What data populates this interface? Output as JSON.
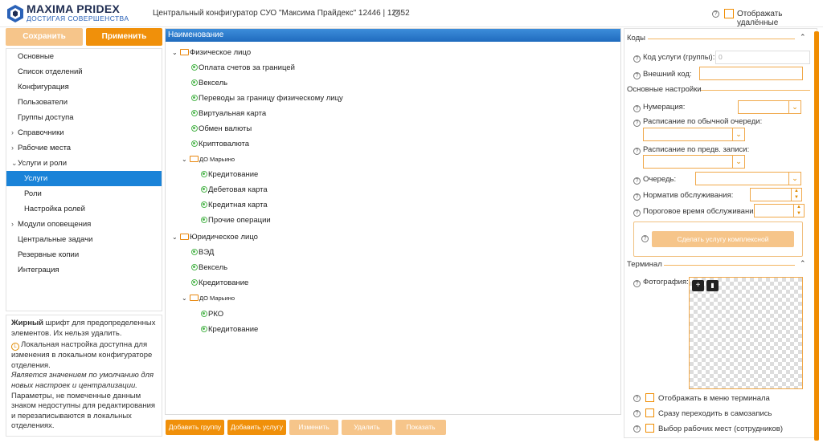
{
  "header": {
    "brand_name": "MAXIMA PRIDEX",
    "brand_tagline": "ДОСТИГАЯ СОВЕРШЕНСТВА",
    "title": "Центральный конфигуратор СУО \"Максима Прайдекс\" 12446 | 12452",
    "show_deleted_label": "Отображать удалённые",
    "help_glyph": "?"
  },
  "toolbar": {
    "save_label": "Сохранить",
    "apply_label": "Применить"
  },
  "sidebar": {
    "items": [
      {
        "label": "Основные",
        "arrow": ""
      },
      {
        "label": "Список отделений",
        "arrow": ""
      },
      {
        "label": "Конфигурация",
        "arrow": ""
      },
      {
        "label": "Пользователи",
        "arrow": ""
      },
      {
        "label": "Группы доступа",
        "arrow": ""
      },
      {
        "label": "Справочники",
        "arrow": "›"
      },
      {
        "label": "Рабочие места",
        "arrow": "›"
      },
      {
        "label": "Услуги и роли",
        "arrow": "⌄"
      },
      {
        "label": "Услуги",
        "arrow": ""
      },
      {
        "label": "Роли",
        "arrow": ""
      },
      {
        "label": "Настройка ролей",
        "arrow": ""
      },
      {
        "label": "Модули оповещения",
        "arrow": "›"
      },
      {
        "label": "Центральные задачи",
        "arrow": ""
      },
      {
        "label": "Резервные копии",
        "arrow": ""
      },
      {
        "label": "Интеграция",
        "arrow": ""
      }
    ]
  },
  "legend": {
    "bold_word": "Жирный",
    "bold_rest": " шрифт для предопределенных элементов. Их нельзя удалить.",
    "local_icon": "L",
    "local_text": "Локальная настройка доступна для изменения в локальном конфигураторе отделения.",
    "italic_text": "Является значением по умолчанию для новых настроек и централизации.",
    "unmarked_text": "Параметры, не помеченные данным знаком недоступны для редактирования и перезаписываются в локальных отделениях."
  },
  "tree": {
    "column_header": "Наименование",
    "nodes": [
      {
        "label": "Физическое лицо"
      },
      {
        "label": "Оплата счетов за границей"
      },
      {
        "label": "Вексель"
      },
      {
        "label": "Переводы за границу физическому лицу"
      },
      {
        "label": "Виртуальная карта"
      },
      {
        "label": "Обмен валюты"
      },
      {
        "label": "Криптовалюта"
      },
      {
        "label": "ДО Марьино"
      },
      {
        "label": "Кредитование"
      },
      {
        "label": "Дебетовая карта"
      },
      {
        "label": "Кредитная карта"
      },
      {
        "label": "Прочие операции"
      },
      {
        "label": "Юридическое лицо"
      },
      {
        "label": "ВЭД"
      },
      {
        "label": "Вексель"
      },
      {
        "label": "Кредитование"
      },
      {
        "label": "ДО Марьино"
      },
      {
        "label": "РКО"
      },
      {
        "label": "Кредитование"
      }
    ]
  },
  "bottom_buttons": {
    "add_group": "Добавить группу",
    "add_service": "Добавить услугу",
    "edit": "Изменить",
    "delete": "Удалить",
    "show": "Показать"
  },
  "right_panel": {
    "codes": {
      "title": "Коды",
      "service_code_label": "Код услуги (группы):",
      "service_code_value": "0",
      "external_code_label": "Внешний код:",
      "external_code_value": ""
    },
    "basic": {
      "title": "Основные настройки",
      "numbering_label": "Нумерация:",
      "schedule_regular_label": "Расписание по обычной очереди:",
      "schedule_prebook_label": "Расписание по предв. записи:",
      "queue_label": "Очередь:",
      "norm_label": "Норматив обслуживания:",
      "threshold_label": "Пороговое время обслуживания:",
      "make_complex_button": "Сделать услугу комплексной"
    },
    "terminal": {
      "title": "Терминал",
      "photo_label": "Фотография:",
      "show_in_menu_label": "Отображать в меню терминала",
      "goto_selfbook_label": "Сразу переходить в самозапись",
      "select_workplaces_label": "Выбор рабочих мест (сотрудников)"
    }
  },
  "colors": {
    "accent": "#f08c00",
    "accent_light": "#f6c58a",
    "selection": "#1a83d8",
    "header_blue": "#1f6bbd",
    "node_green": "#4fb64f",
    "brand_dark": "#1f2d52"
  }
}
